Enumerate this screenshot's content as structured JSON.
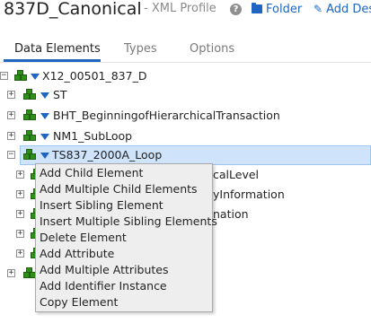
{
  "header": {
    "title": "837D_Canonical",
    "subtitle": "- XML Profile",
    "help_icon": "?",
    "folder_label": "Folder",
    "add_label": "Add Des"
  },
  "tabs": [
    {
      "label": "Data Elements",
      "active": true
    },
    {
      "label": "Types",
      "active": false
    },
    {
      "label": "Options",
      "active": false
    }
  ],
  "tree": {
    "root": {
      "label": "X12_00501_837_D",
      "expander": "−"
    },
    "items": [
      {
        "label": "ST",
        "expander": "+"
      },
      {
        "label": "BHT_BeginningofHierarchicalTransaction",
        "expander": "+"
      },
      {
        "label": "NM1_SubLoop",
        "expander": "+"
      },
      {
        "label": "TS837_2000A_Loop",
        "expander": "−",
        "selected": true
      }
    ],
    "partial_children": [
      "calLevel",
      "yInformation",
      "nation"
    ]
  },
  "context_menu": {
    "items": [
      "Add Child Element",
      "Add Multiple Child Elements",
      "Insert Sibling Element",
      "Insert Multiple Sibling Elements",
      "Delete Element",
      "Add Attribute",
      "Add Multiple Attributes",
      "Add Identifier Instance",
      "Copy Element"
    ]
  },
  "colors": {
    "accent": "#1e66c2",
    "selection": "#cfe4fb",
    "cube_green": "#2f8f1b"
  }
}
